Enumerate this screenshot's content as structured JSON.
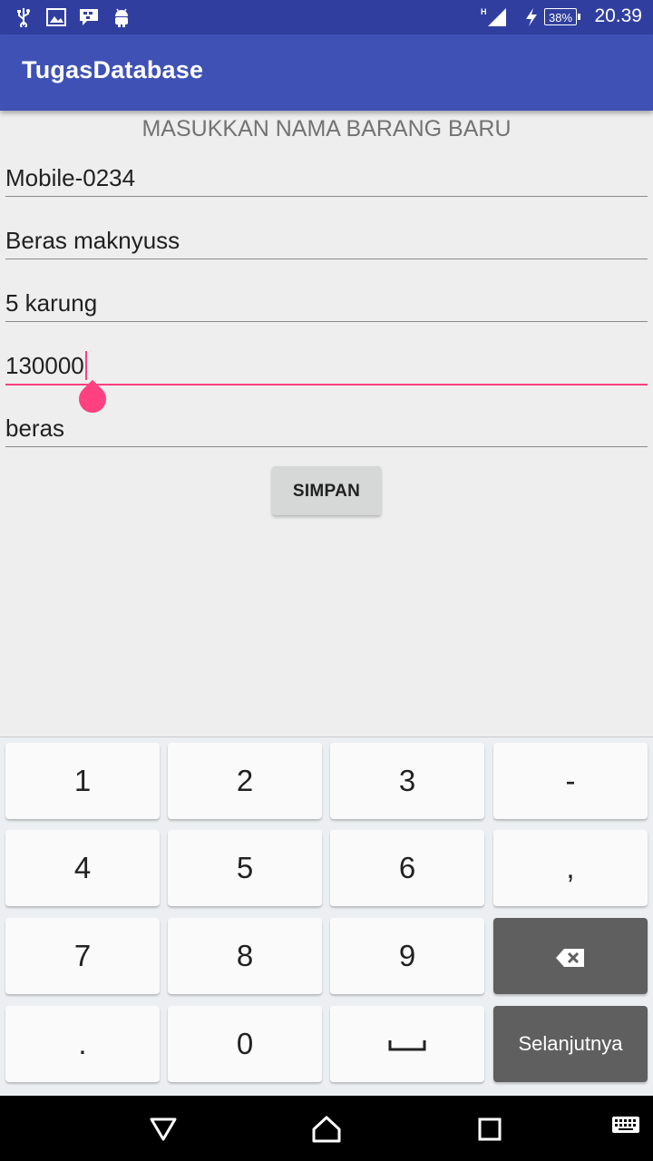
{
  "status_bar": {
    "time": "20.39",
    "battery": "38%",
    "network": "H",
    "icons": [
      "usb-icon",
      "image-icon",
      "bbm-icon",
      "android-icon",
      "signal-icon",
      "charging-icon"
    ]
  },
  "app_bar": {
    "title": "TugasDatabase"
  },
  "form": {
    "heading": "MASUKKAN NAMA BARANG BARU",
    "fields": [
      {
        "value": "Mobile-0234"
      },
      {
        "value": "Beras maknyuss"
      },
      {
        "value": "5 karung"
      },
      {
        "value": "130000",
        "focused": true
      },
      {
        "value": "beras"
      }
    ],
    "submit_label": "SIMPAN"
  },
  "keyboard": {
    "rows": [
      [
        "1",
        "2",
        "3",
        "-"
      ],
      [
        "4",
        "5",
        "6",
        ","
      ],
      [
        "7",
        "8",
        "9",
        "backspace"
      ],
      [
        ".",
        "0",
        "space",
        "Selanjutnya"
      ]
    ]
  },
  "nav_bar": {
    "icons": [
      "back-icon",
      "home-icon",
      "recents-icon",
      "keyboard-switch-icon"
    ]
  },
  "colors": {
    "status_bar": "#303f9f",
    "app_bar": "#3f51b5",
    "accent": "#ff4081",
    "background": "#eeeeee"
  }
}
